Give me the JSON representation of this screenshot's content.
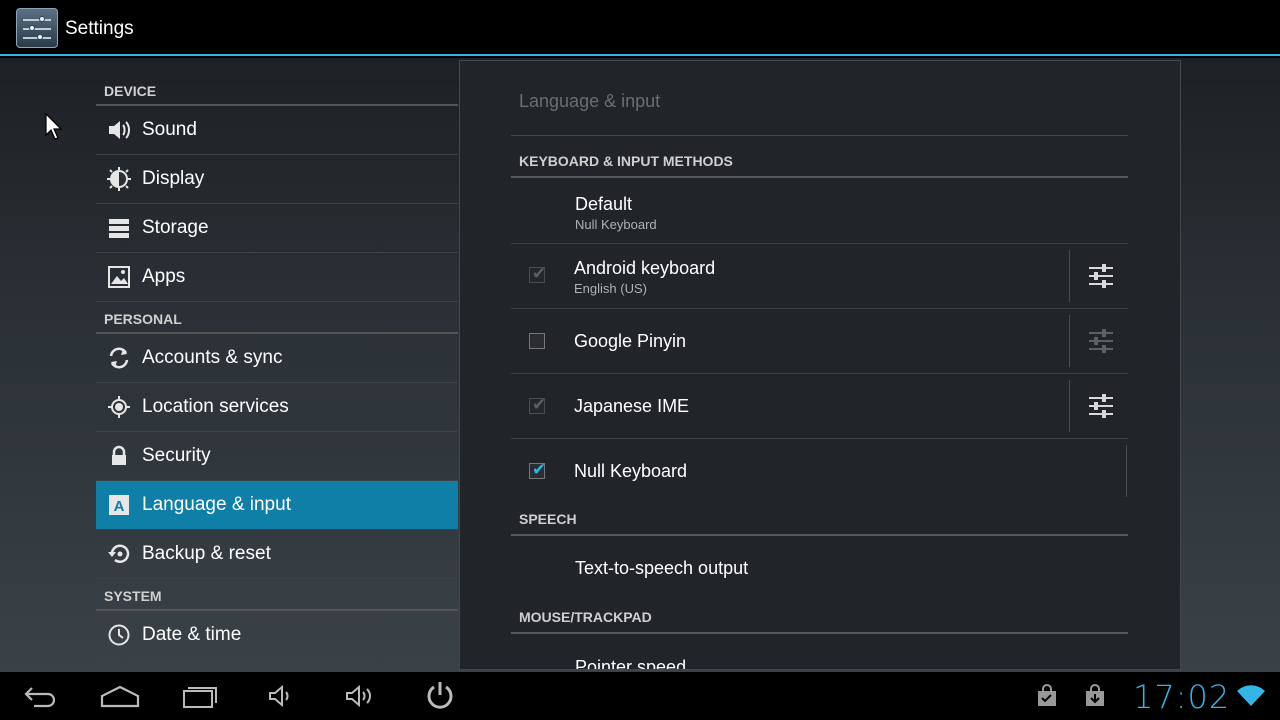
{
  "actionbar": {
    "title": "Settings",
    "icon": "settings-sliders-icon"
  },
  "sidebar": {
    "sections": [
      {
        "header": "DEVICE",
        "items": [
          {
            "label": "Sound",
            "icon": "volume-icon"
          },
          {
            "label": "Display",
            "icon": "brightness-icon"
          },
          {
            "label": "Storage",
            "icon": "storage-icon"
          },
          {
            "label": "Apps",
            "icon": "apps-icon"
          }
        ]
      },
      {
        "header": "PERSONAL",
        "items": [
          {
            "label": "Accounts & sync",
            "icon": "sync-icon"
          },
          {
            "label": "Location services",
            "icon": "location-icon"
          },
          {
            "label": "Security",
            "icon": "lock-icon"
          },
          {
            "label": "Language & input",
            "icon": "language-icon",
            "selected": true
          },
          {
            "label": "Backup & reset",
            "icon": "backup-icon"
          }
        ]
      },
      {
        "header": "SYSTEM",
        "items": [
          {
            "label": "Date & time",
            "icon": "clock-icon"
          }
        ]
      }
    ]
  },
  "panel": {
    "title": "Language & input",
    "keyboard_header": "KEYBOARD & INPUT METHODS",
    "default": {
      "title": "Default",
      "subtitle": "Null Keyboard"
    },
    "methods": [
      {
        "title": "Android keyboard",
        "subtitle": "English (US)",
        "checked": true,
        "enabled": false
      },
      {
        "title": "Google Pinyin",
        "subtitle": "",
        "checked": false,
        "enabled": true
      },
      {
        "title": "Japanese IME",
        "subtitle": "",
        "checked": true,
        "enabled": false
      },
      {
        "title": "Null Keyboard",
        "subtitle": "",
        "checked": true,
        "enabled": true
      }
    ],
    "speech_header": "SPEECH",
    "tts": "Text-to-speech output",
    "mouse_header": "MOUSE/TRACKPAD",
    "pointer_speed": "Pointer speed"
  },
  "navbar": {
    "buttons": [
      "back-icon",
      "home-icon",
      "recent-apps-icon",
      "volume-down-icon",
      "volume-up-icon",
      "power-icon"
    ],
    "status_icons": [
      "shopping-bag-check-icon",
      "download-icon",
      "wifi-icon"
    ],
    "clock": "17:02"
  },
  "colors": {
    "accent": "#33b5e5",
    "selected": "#0f7fa8"
  }
}
